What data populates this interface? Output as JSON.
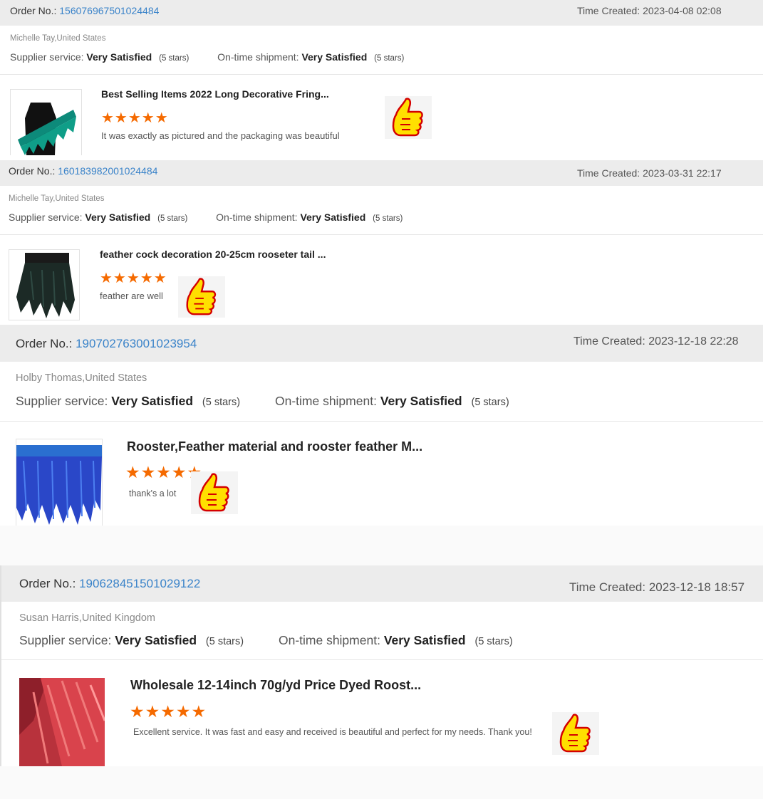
{
  "labels": {
    "order_no": "Order No.:",
    "time_created": "Time Created:",
    "supplier_service": "Supplier service:",
    "on_time_shipment": "On-time shipment:"
  },
  "colors": {
    "accent_link": "#3a83c9",
    "star": "#f56a00",
    "header_bg": "#ececec"
  },
  "orders": [
    {
      "order_no": "156076967501024484",
      "time_created": "2023-04-08 02:08",
      "buyer": "Michelle Tay,United States",
      "supplier_rating": "Very Satisfied",
      "supplier_stars": "(5 stars)",
      "shipment_rating": "Very Satisfied",
      "shipment_stars": "(5 stars)",
      "product_title": "Best Selling Items 2022 Long Decorative Fring...",
      "product_image": "green-feather-trim-image",
      "rating": 5,
      "stars": "★★★★★",
      "comment": "It was exactly as pictured and the packaging was beautiful",
      "icon": "thumbs-up-icon"
    },
    {
      "order_no": "160183982001024484",
      "time_created": "2023-03-31 22:17",
      "buyer": "Michelle Tay,United States",
      "supplier_rating": "Very Satisfied",
      "supplier_stars": "(5 stars)",
      "shipment_rating": "Very Satisfied",
      "shipment_stars": "(5 stars)",
      "product_title": "feather cock decoration 20-25cm rooseter tail ...",
      "product_image": "black-feather-fringe-image",
      "rating": 5,
      "stars": "★★★★★",
      "comment": "feather are well",
      "icon": "thumbs-up-icon"
    },
    {
      "order_no": "190702763001023954",
      "time_created": "2023-12-18 22:28",
      "buyer": "Holby Thomas,United States",
      "supplier_rating": "Very Satisfied",
      "supplier_stars": "(5 stars)",
      "shipment_rating": "Very Satisfied",
      "shipment_stars": "(5 stars)",
      "product_title": "Rooster,Feather material and rooster feather M...",
      "product_image": "blue-feather-fringe-image",
      "rating": 5,
      "stars": "★★★★★",
      "comment": "thank's a lot",
      "icon": "thumbs-up-icon"
    },
    {
      "order_no": "190628451501029122",
      "time_created": "2023-12-18 18:57",
      "buyer": "Susan Harris,United Kingdom",
      "supplier_rating": "Very Satisfied",
      "supplier_stars": "(5 stars)",
      "shipment_rating": "Very Satisfied",
      "shipment_stars": "(5 stars)",
      "product_title": "Wholesale 12-14inch 70g/yd Price Dyed Roost...",
      "product_image": "red-feather-fringe-image",
      "rating": 5,
      "stars": "★★★★★",
      "comment": "Excellent service. It was fast and easy and received is beautiful and perfect for my needs. Thank you!",
      "icon": "thumbs-up-icon"
    }
  ]
}
